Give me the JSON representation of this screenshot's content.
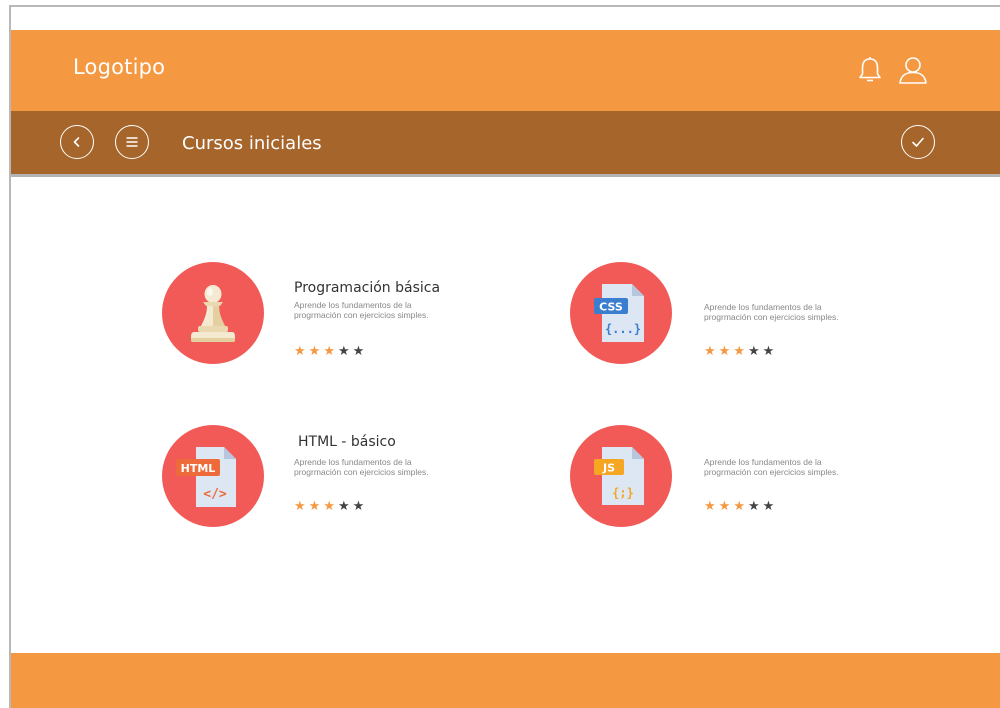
{
  "header": {
    "logo": "Logotipo",
    "icons": [
      "bell-icon",
      "user-icon"
    ]
  },
  "subheader": {
    "title": "Cursos iniciales",
    "icons": [
      "back-icon",
      "menu-icon",
      "check-icon"
    ]
  },
  "courses": [
    {
      "title": "Programación básica",
      "description": "Aprende los fundamentos de la progrmación con ejercicios simples.",
      "icon": "chess-pawn-icon",
      "rating": 3,
      "max_rating": 5
    },
    {
      "title": "",
      "description": "Aprende los fundamentos de la progrmación con ejercicios simples.",
      "icon": "css-file-icon",
      "badge_text": "CSS",
      "rating": 3,
      "max_rating": 5
    },
    {
      "title": "HTML - básico",
      "description": "Aprende los fundamentos de la progrmación con ejercicios simples.",
      "icon": "html-file-icon",
      "badge_text": "HTML",
      "rating": 3,
      "max_rating": 5
    },
    {
      "title": "",
      "description": "Aprende los fundamentos de la progrmación con ejercicios simples.",
      "icon": "js-file-icon",
      "badge_text": "JS",
      "rating": 3,
      "max_rating": 5
    }
  ],
  "colors": {
    "header": "#f59842",
    "subheader": "#a5652b",
    "badge": "#f15a57",
    "star_on": "#f59842",
    "star_off": "#444444",
    "footer": "#f59842"
  }
}
